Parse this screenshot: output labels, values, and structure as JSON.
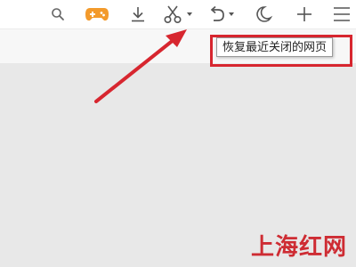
{
  "toolbar": {
    "buttons": [
      {
        "name": "search",
        "icon": "search-icon"
      },
      {
        "name": "game-center",
        "icon": "gamepad-icon"
      },
      {
        "name": "downloads",
        "icon": "download-icon"
      },
      {
        "name": "screenshot",
        "icon": "scissors-icon"
      },
      {
        "name": "restore-closed",
        "icon": "undo-arrow-icon"
      },
      {
        "name": "night-mode",
        "icon": "moon-icon"
      },
      {
        "name": "new-tab",
        "icon": "plus-icon"
      },
      {
        "name": "menu",
        "icon": "hamburger-menu-icon"
      }
    ]
  },
  "tooltip": {
    "text": "恢复最近关闭的网页"
  },
  "colors": {
    "accent_orange": "#f39a2b",
    "annotation_red": "#d7262f",
    "icon_gray": "#555555"
  },
  "watermark": {
    "text": "上海红网"
  }
}
